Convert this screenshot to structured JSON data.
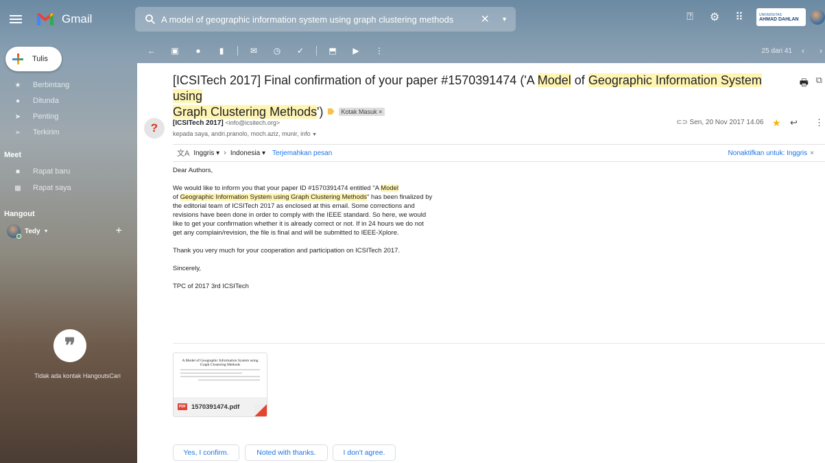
{
  "app": {
    "name": "Gmail"
  },
  "search": {
    "query": "A model of geographic information system using graph clustering methods"
  },
  "header": {
    "org_small": "UNIVERSITAS",
    "org_name": "AHMAD DAHLAN"
  },
  "sidebar": {
    "compose_label": "Tulis",
    "items": [
      {
        "label": "Berbintang",
        "icon": "star-icon"
      },
      {
        "label": "Ditunda",
        "icon": "clock-icon"
      },
      {
        "label": "Penting",
        "icon": "important-icon"
      },
      {
        "label": "Terkirim",
        "icon": "send-icon"
      }
    ],
    "meet_title": "Meet",
    "meet_items": [
      {
        "label": "Rapat baru",
        "icon": "video-icon"
      },
      {
        "label": "Rapat saya",
        "icon": "calendar-icon"
      }
    ],
    "hangout_title": "Hangout",
    "hangout_user": "Tedy",
    "no_hangouts": "Tidak ada kontak HangoutsCari"
  },
  "toolbar": {
    "date": "25 dari 41"
  },
  "email": {
    "subject_parts": [
      "[ICSITech 2017] Final confirmation of your paper #1570391474 ('A ",
      "Model",
      " of ",
      "Geographic Information System",
      " ",
      "using",
      "Graph Clustering Methods",
      "')"
    ],
    "label": "Kotak Masuk",
    "sender_name": "[ICSITech 2017]",
    "sender_email": "<info@icsitech.org>",
    "recipients": "kepada saya, andri.pranolo, moch.aziz, munir, info",
    "date": "Sen, 20 Nov 2017 14.06",
    "translate": {
      "from": "Inggris",
      "to": "Indonesia",
      "action": "Terjemahkan pesan",
      "disable": "Nonaktifkan untuk: Inggris"
    },
    "greeting": "Dear Authors,",
    "p1": {
      "a": "We would like to inform you that your paper ID #1570391474 entitled \"A ",
      "b": "Model",
      "c": "of ",
      "d": "Geographic Information System using Graph Clustering Methods",
      "e": "\" has been finalized by the editorial team of ICSITech 2017 as enclosed at this email. Some corrections and revisions have been done in order to comply with the IEEE standard. So here, we would like to get your confirmation whether it is already correct or not. If in 24 hours we do not get any complain/revision, the file is final and will be submitted to IEEE-Xplore."
    },
    "p2": "Thank you very much for your cooperation and participation on ICSITech 2017.",
    "p3": "Sincerely,",
    "p4": "TPC of 2017 3rd ICSITech",
    "attachment": {
      "filename": "1570391474.pdf",
      "preview_title": "A Model of Geographic Information System using Graph Clustering Methods"
    },
    "smart_replies": [
      "Yes, I confirm.",
      "Noted with thanks.",
      "I don't agree."
    ]
  }
}
